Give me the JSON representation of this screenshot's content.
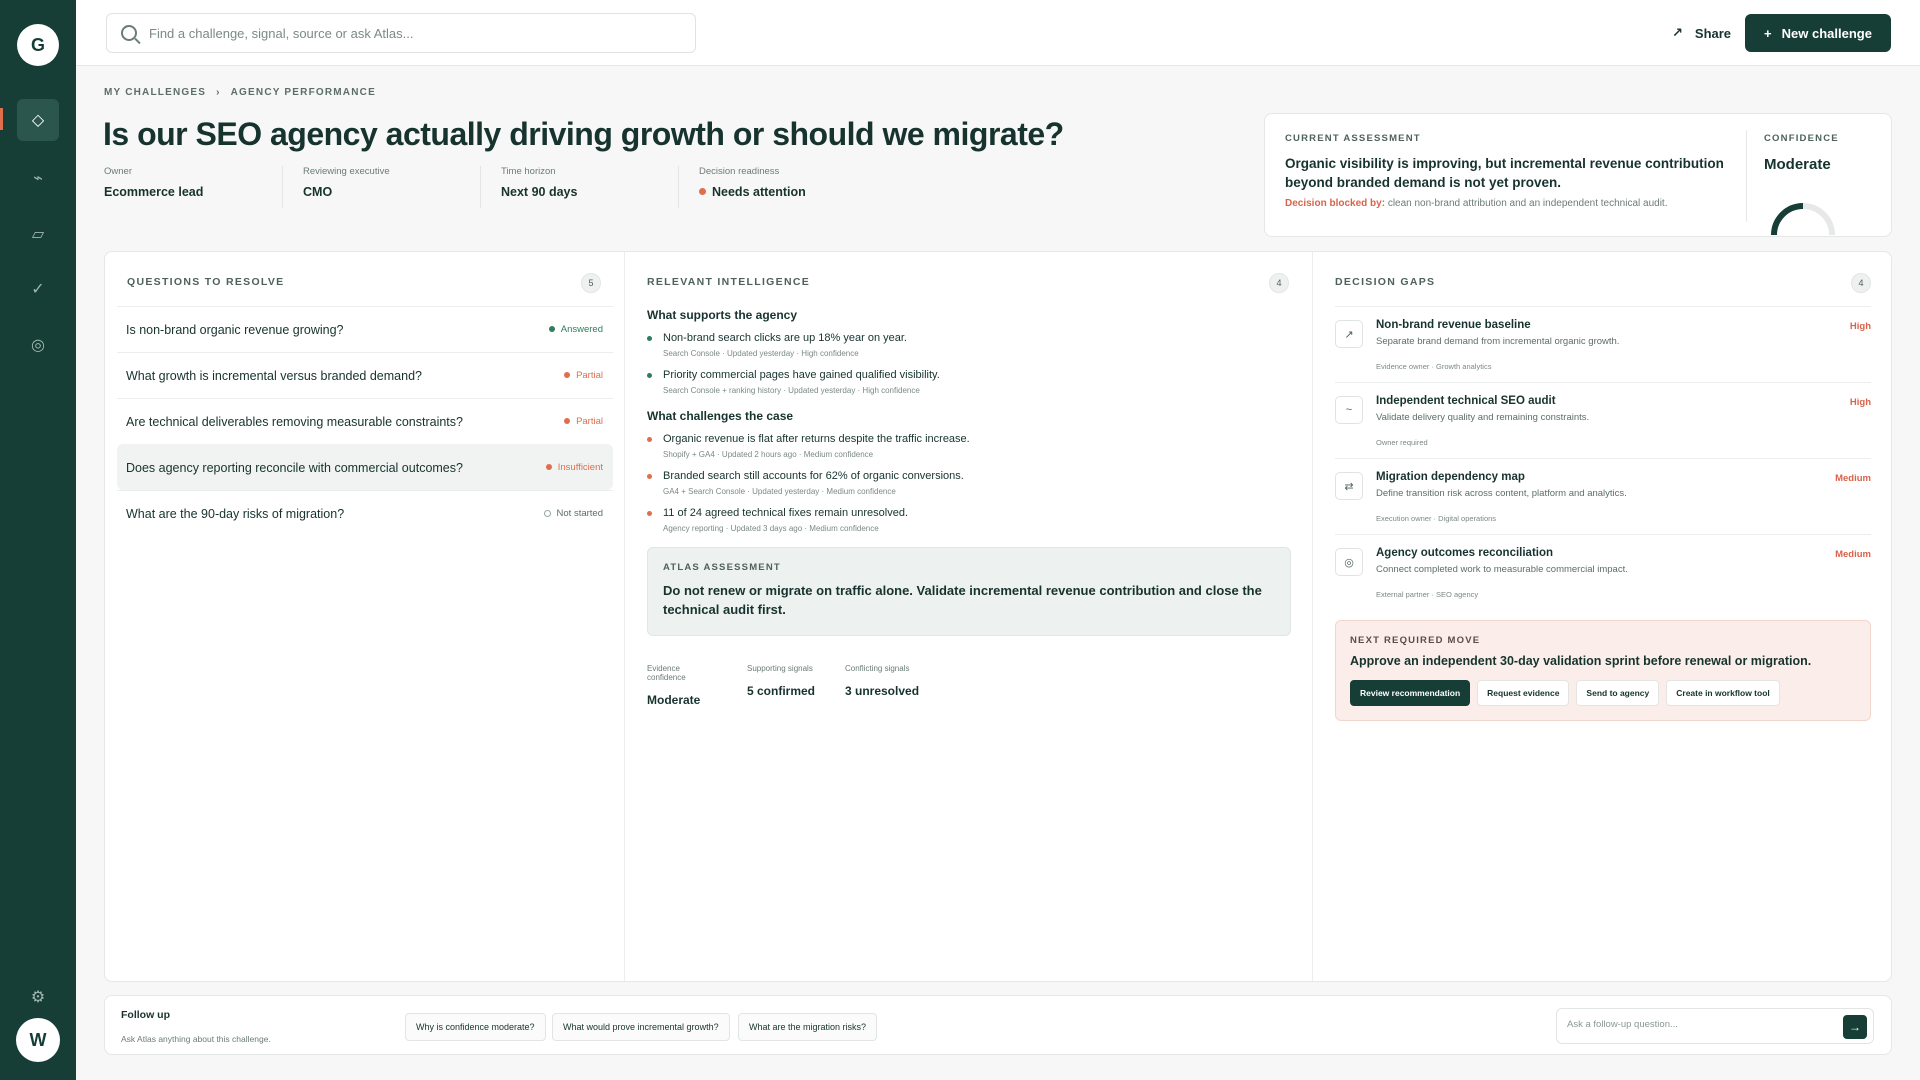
{
  "sidebar": {
    "logo_letter": "G",
    "items": [
      {
        "name": "diamond-icon",
        "glyph": "◇"
      },
      {
        "name": "activity-icon",
        "glyph": "⌁"
      },
      {
        "name": "folder-icon",
        "glyph": "▱"
      },
      {
        "name": "check-icon",
        "glyph": "✓"
      },
      {
        "name": "target-icon",
        "glyph": "◎"
      }
    ],
    "settings_glyph": "⚙",
    "avatar_letter": "W"
  },
  "topbar": {
    "search_placeholder": "Find a challenge, signal, source or ask Atlas...",
    "share_icon": "↗",
    "share_label": "Share",
    "new_icon": "+",
    "new_label": "New challenge"
  },
  "header": {
    "breadcrumb": [
      "MY CHALLENGES",
      "›",
      "AGENCY PERFORMANCE"
    ],
    "title": "Is our SEO agency actually driving growth or should we migrate?",
    "meta": [
      {
        "label": "Owner",
        "value": "Ecommerce lead"
      },
      {
        "label": "Reviewing executive",
        "value": "CMO"
      },
      {
        "label": "Time horizon",
        "value": "Next 90 days"
      },
      {
        "label": "Decision readiness",
        "value": "Needs attention"
      }
    ],
    "readiness_color": "#e06d4c"
  },
  "assessment": {
    "label": "CURRENT ASSESSMENT",
    "text": "Organic visibility is improving, but incremental revenue contribution beyond branded demand is not yet proven.",
    "blocked_label": "Decision blocked by:",
    "blocked_text": "clean non-brand attribution and an independent technical audit.",
    "confidence_label": "CONFIDENCE",
    "confidence_value": "Moderate",
    "confidence_level": 0.5
  },
  "questions": {
    "title": "QUESTIONS TO RESOLVE",
    "count": "5",
    "items": [
      {
        "text": "Is non-brand organic revenue growing?",
        "status": "Answered",
        "color": "#2f7d5b"
      },
      {
        "text": "What growth is incremental versus branded demand?",
        "status": "Partial",
        "color": "#e06d4c"
      },
      {
        "text": "Are technical deliverables removing measurable constraints?",
        "status": "Partial",
        "color": "#e06d4c"
      },
      {
        "text": "Does agency reporting reconcile with commercial outcomes?",
        "status": "Insufficient",
        "color": "#e06d4c"
      },
      {
        "text": "What are the 90-day risks of migration?",
        "status": "Not started",
        "color": "#5d6e6a"
      }
    ]
  },
  "intelligence": {
    "title": "RELEVANT INTELLIGENCE",
    "count": "4",
    "supports_heading": "What supports the agency",
    "supports": [
      {
        "text": "Non-brand search clicks are up 18% year on year.",
        "meta": "Search Console · Updated yesterday · High confidence"
      },
      {
        "text": "Priority commercial pages have gained qualified visibility.",
        "meta": "Search Console + ranking history · Updated yesterday · High confidence"
      }
    ],
    "challenges_heading": "What challenges the case",
    "challenges": [
      {
        "text": "Organic revenue is flat after returns despite the traffic increase.",
        "meta": "Shopify + GA4 · Updated 2 hours ago · Medium confidence"
      },
      {
        "text": "Branded search still accounts for 62% of organic conversions.",
        "meta": "GA4 + Search Console · Updated yesterday · Medium confidence"
      },
      {
        "text": "11 of 24 agreed technical fixes remain unresolved.",
        "meta": "Agency reporting · Updated 3 days ago · Medium confidence"
      }
    ],
    "support_color": "#2f7d5b",
    "challenge_color": "#e06d4c",
    "atlas_label": "ATLAS ASSESSMENT",
    "atlas_text": "Do not renew or migrate on traffic alone. Validate incremental revenue contribution and close the technical audit first.",
    "stats": [
      {
        "label": "Evidence confidence",
        "value": "Moderate"
      },
      {
        "label": "Supporting signals",
        "value": "5 confirmed"
      },
      {
        "label": "Conflicting signals",
        "value": "3 unresolved"
      }
    ]
  },
  "gaps": {
    "title": "DECISION GAPS",
    "count": "4",
    "items": [
      {
        "icon": "↗",
        "icon_name": "trend-up-icon",
        "title": "Non-brand revenue baseline",
        "desc": "Separate brand demand from incremental organic growth.",
        "meta": "Evidence owner · Growth analytics",
        "severity": "High"
      },
      {
        "icon": "~",
        "icon_name": "wave-icon",
        "title": "Independent technical SEO audit",
        "desc": "Validate delivery quality and remaining constraints.",
        "meta": "Owner required",
        "severity": "High"
      },
      {
        "icon": "⇄",
        "icon_name": "swap-icon",
        "title": "Migration dependency map",
        "desc": "Define transition risk across content, platform and analytics.",
        "meta": "Execution owner · Digital operations",
        "severity": "Medium"
      },
      {
        "icon": "◎",
        "icon_name": "target-icon",
        "title": "Agency outcomes reconciliation",
        "desc": "Connect completed work to measurable commercial impact.",
        "meta": "External partner · SEO agency",
        "severity": "Medium"
      }
    ],
    "next_label": "NEXT REQUIRED MOVE",
    "next_text": "Approve an independent 30-day validation sprint before renewal or migration.",
    "actions": [
      "Review recommendation",
      "Request evidence",
      "Send to agency",
      "Create in workflow tool"
    ]
  },
  "followup": {
    "title": "Follow up",
    "subtitle": "Ask Atlas anything about this challenge.",
    "chips": [
      "Why is confidence moderate?",
      "What would prove incremental growth?",
      "What are the migration risks?"
    ],
    "input_placeholder": "Ask a follow-up question...",
    "send_icon": "→"
  }
}
